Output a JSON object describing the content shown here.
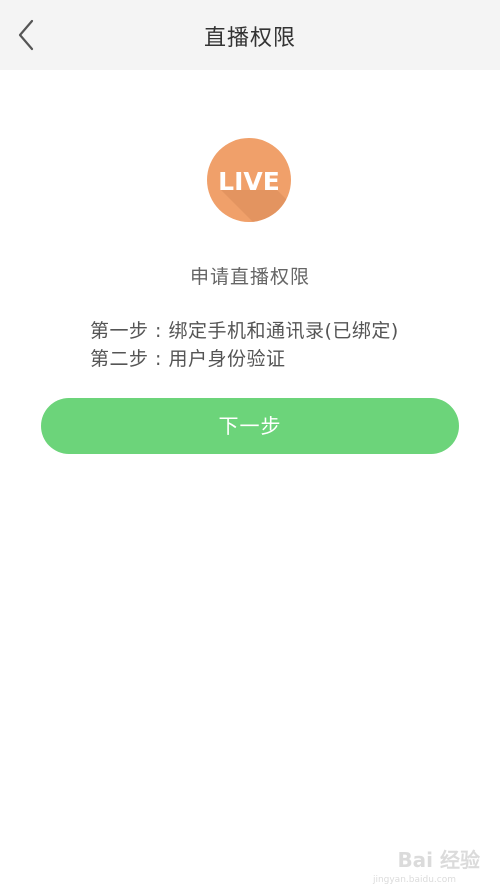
{
  "header": {
    "title": "直播权限",
    "back_icon": "chevron-left-icon"
  },
  "logo": {
    "text": "LIVE",
    "circle_color": "#f0a06a",
    "shadow_color": "#d98a57"
  },
  "content": {
    "apply_title": "申请直播权限",
    "steps": [
      "第一步 : 绑定手机和通讯录(已绑定)",
      "第二步 : 用户身份验证"
    ]
  },
  "actions": {
    "next_label": "下一步",
    "next_color": "#6cd47a"
  },
  "watermark": {
    "text": "Bai 经验",
    "sub": "jingyan.baidu.com"
  }
}
